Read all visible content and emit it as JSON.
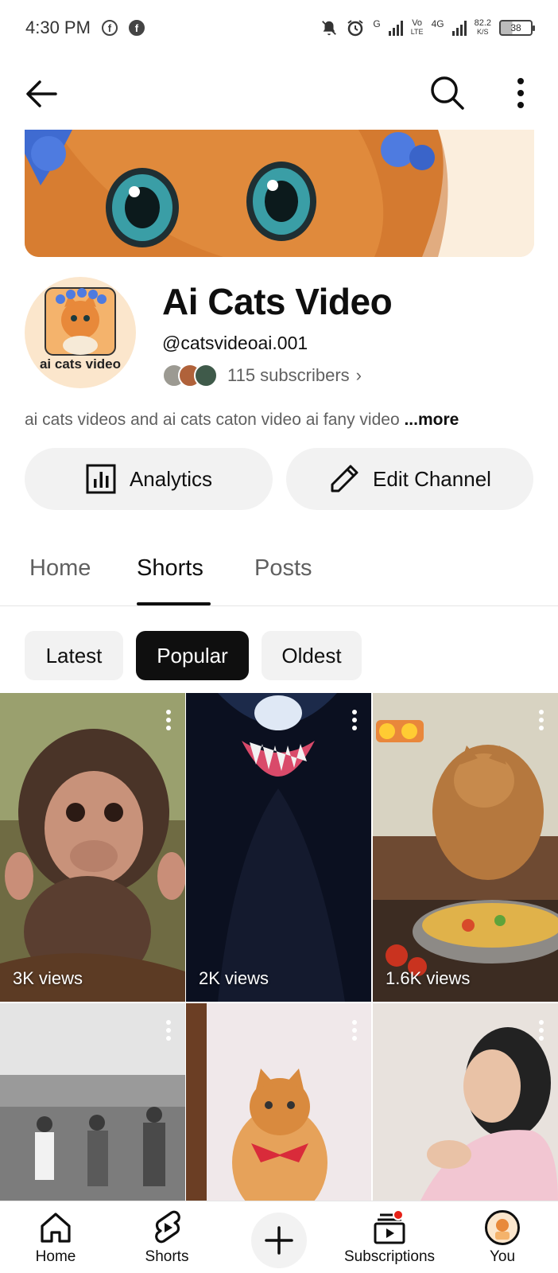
{
  "status_bar": {
    "time": "4:30 PM",
    "net_type_1": "G",
    "volte_top": "Vo",
    "volte_bottom": "LTE",
    "net_type_2": "4G",
    "speed_value": "82.2",
    "speed_unit": "K/S",
    "battery": "38"
  },
  "channel": {
    "name": "Ai Cats Video",
    "handle": "@catsvideoai.001",
    "subscribers": "115 subscribers",
    "avatar_text": "ai cats video",
    "description": "ai cats videos and ai cats caton video ai fany video ",
    "description_more": "...more"
  },
  "actions": {
    "analytics_label": "Analytics",
    "edit_label": "Edit Channel"
  },
  "tabs": [
    {
      "label": "Home",
      "active": false
    },
    {
      "label": "Shorts",
      "active": true
    },
    {
      "label": "Posts",
      "active": false
    }
  ],
  "chips": [
    {
      "label": "Latest",
      "selected": false
    },
    {
      "label": "Popular",
      "selected": true
    },
    {
      "label": "Oldest",
      "selected": false
    }
  ],
  "shorts": [
    {
      "views": "3K views",
      "subject": "baby-monkey"
    },
    {
      "views": "2K views",
      "subject": "venom"
    },
    {
      "views": "1.6K views",
      "subject": "cat-cooking"
    },
    {
      "views": "",
      "subject": "men-dancing"
    },
    {
      "views": "",
      "subject": "orange-cat"
    },
    {
      "views": "",
      "subject": "woman"
    }
  ],
  "bottom_nav": {
    "home": "Home",
    "shorts": "Shorts",
    "subscriptions": "Subscriptions",
    "you": "You"
  },
  "colors": {
    "accent_red": "#e62117",
    "chip_bg": "#f2f2f2",
    "text_primary": "#0f0f0f",
    "text_secondary": "#606060"
  }
}
